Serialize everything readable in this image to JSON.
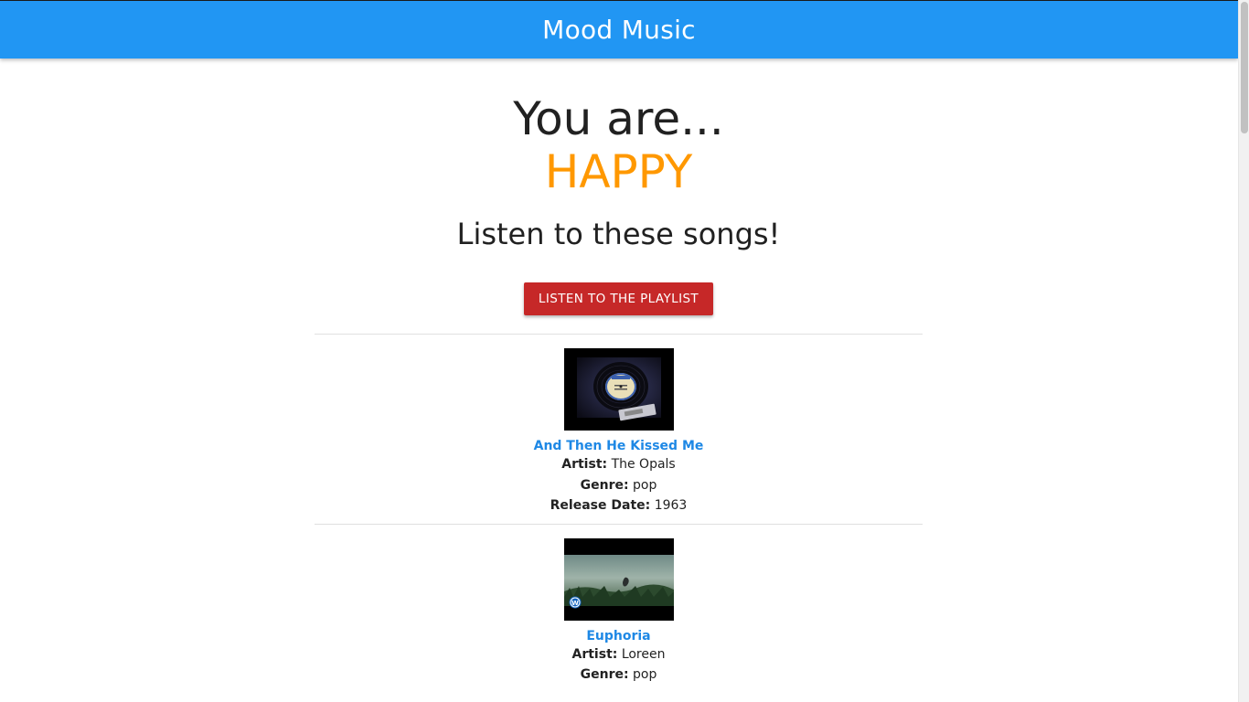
{
  "header": {
    "brand": "Mood Music"
  },
  "result": {
    "lead": "You are...",
    "mood": "HAPPY",
    "mood_color": "#ff9800",
    "subtitle": "Listen to these songs!",
    "playlist_button": "LISTEN TO THE PLAYLIST"
  },
  "labels": {
    "artist": "Artist:",
    "genre": "Genre:",
    "release": "Release Date:"
  },
  "songs": [
    {
      "title": "And Then He Kissed Me",
      "artist": "The Opals",
      "genre": "pop",
      "release": "1963",
      "thumbnail": "vinyl-record-thumbnail"
    },
    {
      "title": "Euphoria",
      "artist": "Loreen",
      "genre": "pop",
      "thumbnail": "music-video-thumbnail"
    }
  ],
  "colors": {
    "appbar": "#2196f3",
    "button": "#c62828",
    "link": "#1e88e5"
  }
}
